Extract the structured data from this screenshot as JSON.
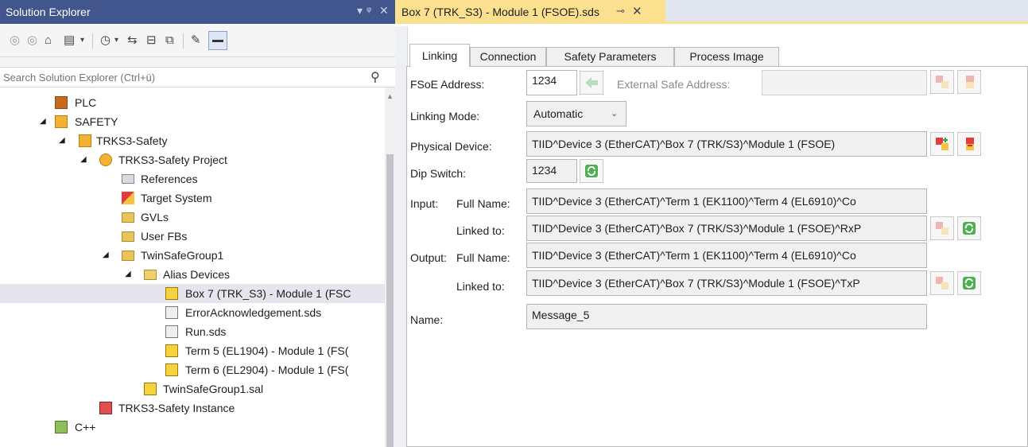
{
  "solution_explorer": {
    "title": "Solution Explorer",
    "search_placeholder": "Search Solution Explorer (Ctrl+ü)",
    "tree": [
      {
        "label": "PLC",
        "icon": "plc-icon"
      },
      {
        "label": "SAFETY",
        "icon": "safety-icon"
      },
      {
        "label": "TRKS3-Safety",
        "icon": "safety-icon"
      },
      {
        "label": "TRKS3-Safety Project",
        "icon": "safety-project-icon"
      },
      {
        "label": "References",
        "icon": "references-icon"
      },
      {
        "label": "Target System",
        "icon": "target-system-icon"
      },
      {
        "label": "GVLs",
        "icon": "folder-icon"
      },
      {
        "label": "User FBs",
        "icon": "folder-icon"
      },
      {
        "label": "TwinSafeGroup1",
        "icon": "group-folder-icon"
      },
      {
        "label": "Alias Devices",
        "icon": "folder-open-icon"
      },
      {
        "label": "Box 7 (TRK_S3) - Module 1 (FSC",
        "icon": "alias-device-icon"
      },
      {
        "label": "ErrorAcknowledgement.sds",
        "icon": "sds-icon"
      },
      {
        "label": "Run.sds",
        "icon": "sds-icon"
      },
      {
        "label": "Term 5 (EL1904) - Module 1 (FS(",
        "icon": "terminal-input-icon"
      },
      {
        "label": "Term 6 (EL2904) - Module 1 (FS(",
        "icon": "terminal-output-icon"
      },
      {
        "label": "TwinSafeGroup1.sal",
        "icon": "sal-icon"
      },
      {
        "label": "TRKS3-Safety Instance",
        "icon": "instance-icon"
      },
      {
        "label": "C++",
        "icon": "cpp-icon"
      }
    ]
  },
  "document": {
    "tab_title": "Box 7 (TRK_S3) - Module 1 (FSOE).sds",
    "tabs": [
      "Linking",
      "Connection",
      "Safety Parameters",
      "Process Image"
    ],
    "fields": {
      "fsoe_address_label": "FSoE Address:",
      "fsoe_address_value": "1234",
      "external_safe_address_label": "External Safe Address:",
      "external_safe_address_value": "",
      "linking_mode_label": "Linking Mode:",
      "linking_mode_value": "Automatic",
      "physical_device_label": "Physical Device:",
      "physical_device_value": "TIID^Device 3 (EtherCAT)^Box 7 (TRK/S3)^Module 1 (FSOE)",
      "dip_switch_label": "Dip Switch:",
      "dip_switch_value": "1234",
      "input_label": "Input:",
      "full_name_label": "Full Name:",
      "input_full_name": "TIID^Device 3 (EtherCAT)^Term 1 (EK1100)^Term 4 (EL6910)^Co",
      "linked_to_label": "Linked to:",
      "input_linked_to": "TIID^Device 3 (EtherCAT)^Box 7 (TRK/S3)^Module 1 (FSOE)^RxP",
      "output_label": "Output:",
      "output_full_name": "TIID^Device 3 (EtherCAT)^Term 1 (EK1100)^Term 4 (EL6910)^Co",
      "output_linked_to": "TIID^Device 3 (EtherCAT)^Box 7 (TRK/S3)^Module 1 (FSOE)^TxP",
      "name_label": "Name:",
      "name_value": "Message_5"
    }
  },
  "colors": {
    "title_bar": "#40568d",
    "doc_tab_active": "#fbe090",
    "selection": "#e5e5ed"
  }
}
